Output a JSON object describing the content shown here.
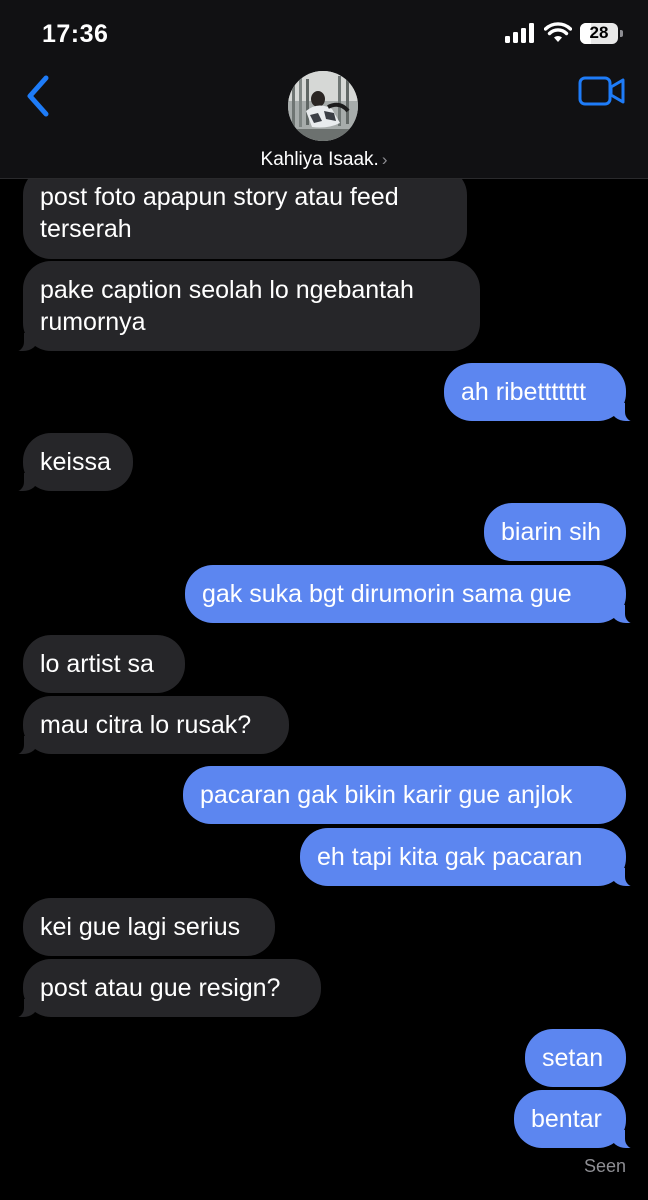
{
  "status_bar": {
    "time": "17:36",
    "battery": "28",
    "battery_level": 0.28
  },
  "header": {
    "contact_name": "Kahliya Isaak.",
    "chevron": "›",
    "back_icon": "chevron-left-icon",
    "video_icon": "video-camera-icon"
  },
  "messages": [
    {
      "dir": "in",
      "text": "post foto apapun story atau feed\nterserah"
    },
    {
      "dir": "in",
      "text": "pake caption seolah lo ngebantah\nrumornya"
    },
    {
      "dir": "out",
      "text": "ah ribettttttt"
    },
    {
      "dir": "in",
      "text": "keissa"
    },
    {
      "dir": "out",
      "text": "biarin sih"
    },
    {
      "dir": "out",
      "text": "gak suka bgt dirumorin sama gue"
    },
    {
      "dir": "in",
      "text": "lo artist sa"
    },
    {
      "dir": "in",
      "text": "mau citra lo rusak?"
    },
    {
      "dir": "out",
      "text": "pacaran gak bikin karir gue anjlok"
    },
    {
      "dir": "out",
      "text": "eh tapi kita gak pacaran"
    },
    {
      "dir": "in",
      "text": "kei gue lagi serius"
    },
    {
      "dir": "in",
      "text": "post atau gue resign?"
    },
    {
      "dir": "out",
      "text": "setan"
    },
    {
      "dir": "out",
      "text": "bentar"
    }
  ],
  "footer": {
    "status": "Seen"
  },
  "colors": {
    "incoming_bubble": "#262629",
    "outgoing_bubble": "#5c86f0",
    "accent": "#1e7cf8",
    "background": "#000000"
  }
}
